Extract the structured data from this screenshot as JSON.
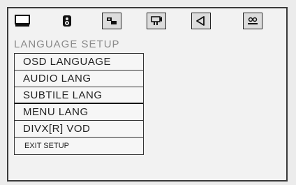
{
  "tabs": [
    {
      "icon": "monitor-icon"
    },
    {
      "icon": "speaker-icon"
    },
    {
      "icon": "dolby-icon"
    },
    {
      "icon": "video-icon"
    },
    {
      "icon": "sound-icon"
    },
    {
      "icon": "misc-icon"
    }
  ],
  "heading": "LANGUAGE SETUP",
  "menu": {
    "items": [
      {
        "label": "OSD LANGUAGE"
      },
      {
        "label": "AUDIO LANG"
      },
      {
        "label": "SUBTILE LANG"
      },
      {
        "label": "MENU LANG"
      },
      {
        "label": "DIVX[R] VOD"
      },
      {
        "label": "EXIT SETUP"
      }
    ]
  }
}
